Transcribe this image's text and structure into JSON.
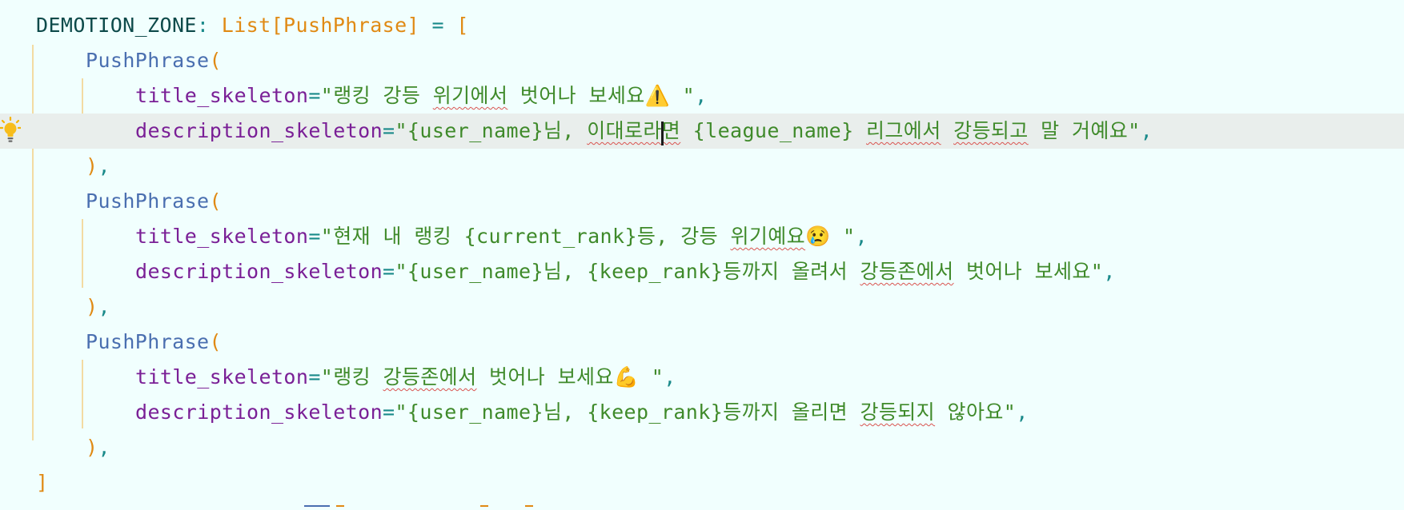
{
  "colors": {
    "background": "#f1fffe",
    "current_line": "#e9eeec",
    "indent_guide": "#f3dba2",
    "variable": "#0d4a4a",
    "type_hint": "#e08a14",
    "class_name": "#4a6fb0",
    "keyword_arg": "#7a1f96",
    "string": "#3f8a2a",
    "operator": "#1a8a8a",
    "typo_underline": "#d9534f"
  },
  "icons": {
    "gutter": "lightbulb-icon",
    "warning": "warning-emoji",
    "crying": "crying-face-emoji",
    "muscle": "flexed-biceps-emoji"
  },
  "code": {
    "line1": {
      "var": "DEMOTION_ZONE",
      "colon": ":",
      "type": "List[PushPhrase]",
      "eq": " = ",
      "open": "["
    },
    "class_name": "PushPhrase",
    "open_paren": "(",
    "close_paren": ")",
    "comma": ",",
    "close_bracket": "]",
    "eq_sign": "=",
    "kw_title": "title_skeleton",
    "kw_desc": "description_skeleton",
    "block1": {
      "title_a": "\"랭킹 강등 ",
      "title_typo": "위기에서",
      "title_b": " 벗어나 보세요",
      "title_emoji": "⚠️",
      "title_end": " \"",
      "desc_a": "\"{user_name}님, ",
      "desc_typo1": "이대로라면",
      "desc_b": " {league_name} ",
      "desc_typo2": "리그에서",
      "desc_c": " ",
      "desc_typo3": "강등되고",
      "desc_d": " 말 거예요\""
    },
    "block2": {
      "title_a": "\"현재 내 랭킹 {current_rank}등, 강등 ",
      "title_typo": "위기예요",
      "title_emoji": "😢",
      "title_end": " \"",
      "desc_a": "\"{user_name}님, {keep_rank}등까지 올려서 ",
      "desc_typo": "강등존에서",
      "desc_b": " 벗어나 보세요\""
    },
    "block3": {
      "title_a": "\"랭킹 ",
      "title_typo": "강등존에서",
      "title_b": " 벗어나 보세요",
      "title_emoji": "💪",
      "title_end": " \"",
      "desc_a": "\"{user_name}님, {keep_rank}등까지 올리면 ",
      "desc_typo": "강등되지",
      "desc_b": " 않아요\""
    }
  }
}
